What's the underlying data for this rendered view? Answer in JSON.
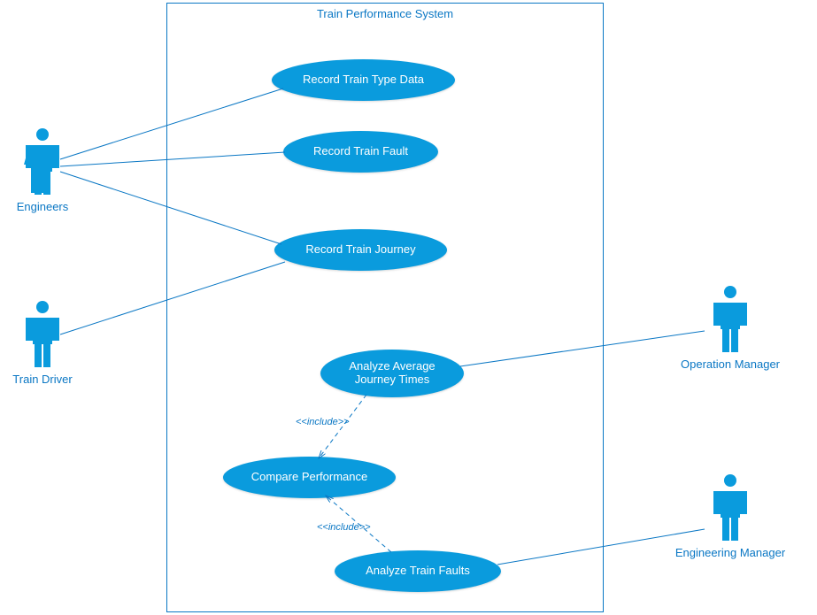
{
  "system": {
    "title": "Train Performance System"
  },
  "actors": {
    "engineers": {
      "label": "Engineers"
    },
    "train_driver": {
      "label": "Train Driver"
    },
    "operation_manager": {
      "label": "Operation Manager"
    },
    "engineering_manager": {
      "label": "Engineering Manager"
    }
  },
  "usecases": {
    "record_train_type": {
      "label": "Record Train Type Data"
    },
    "record_train_fault": {
      "label": "Record Train Fault"
    },
    "record_train_journey": {
      "label": "Record Train Journey"
    },
    "analyze_avg_journey": {
      "label": "Analyze Average\nJourney Times"
    },
    "compare_performance": {
      "label": "Compare Performance"
    },
    "analyze_train_faults": {
      "label": "Analyze Train Faults"
    }
  },
  "relations": {
    "include1": "<<include>>",
    "include2": "<<include>>"
  },
  "colors": {
    "accent": "#0a9bdd",
    "stroke": "#0a77c4"
  }
}
